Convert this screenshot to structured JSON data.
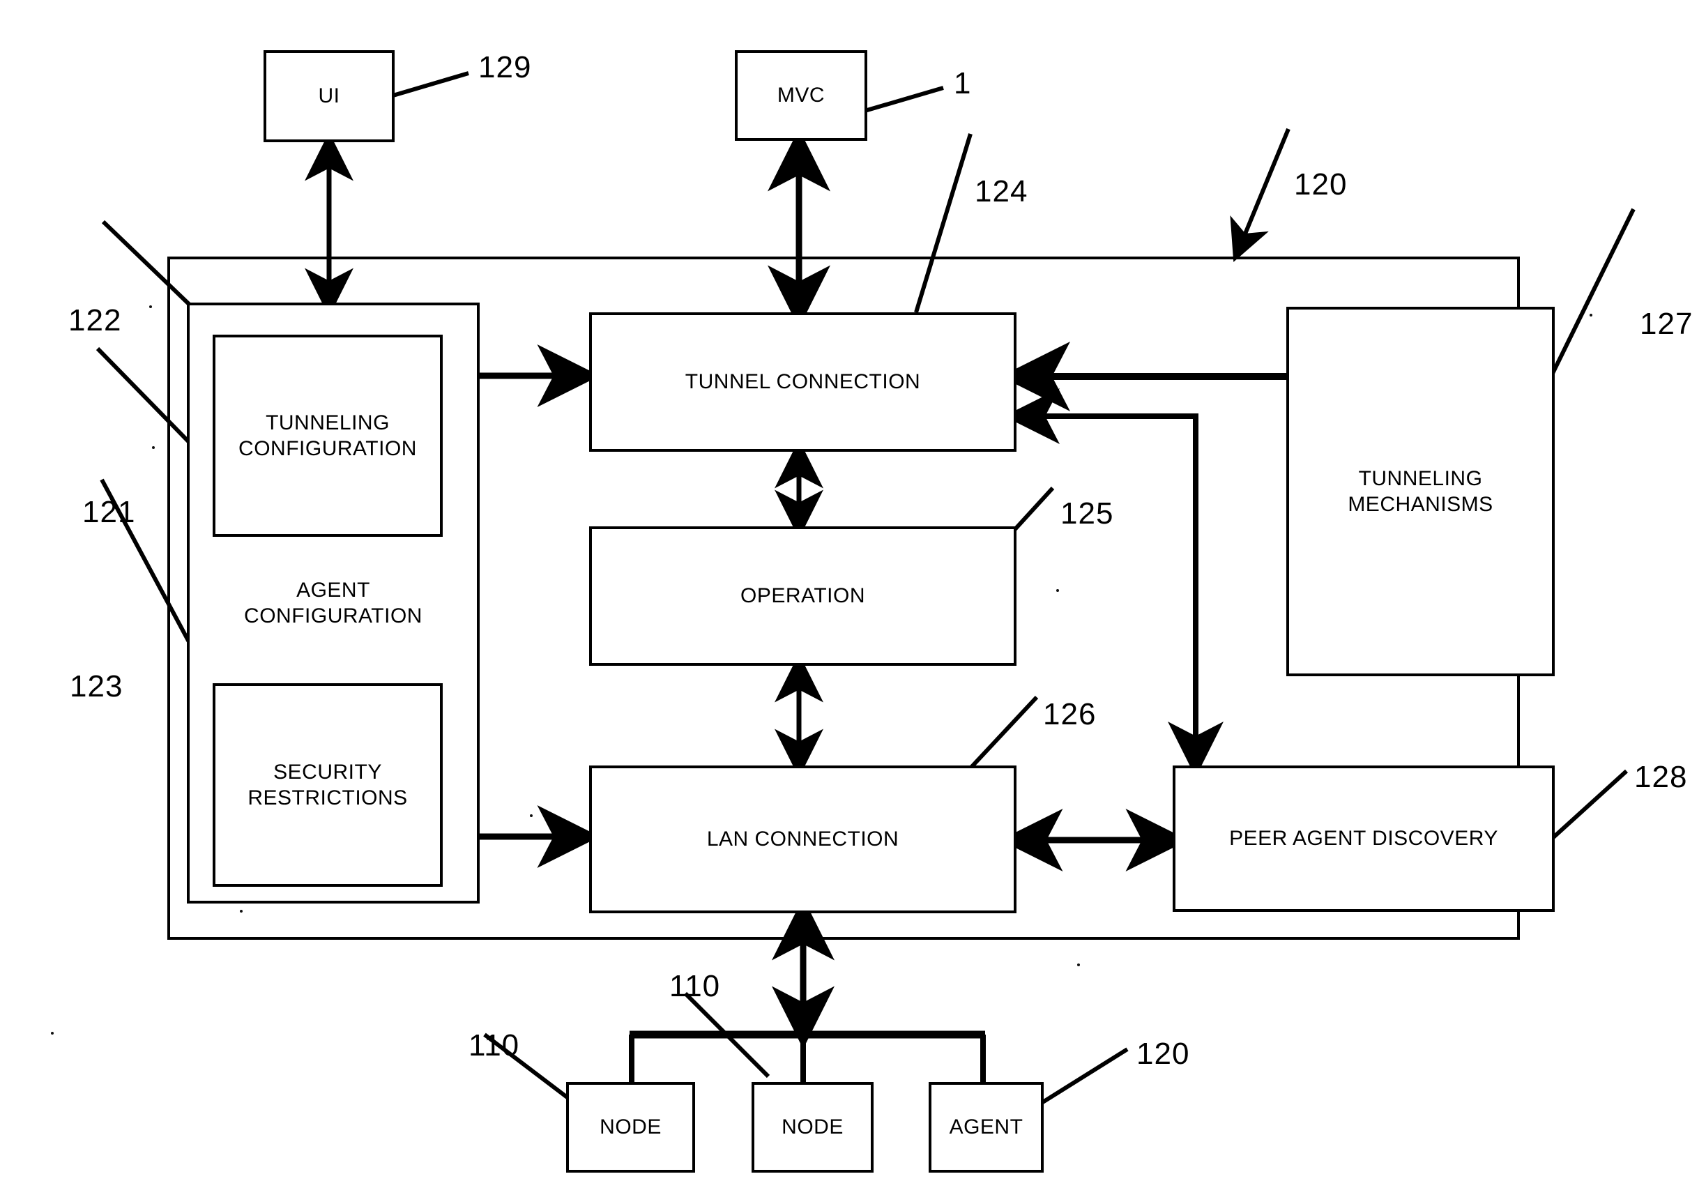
{
  "figure": {
    "type": "patent-block-diagram",
    "background": "#ffffff",
    "ink": "#000000"
  },
  "blocks": {
    "ui": {
      "label": "UI"
    },
    "mvc": {
      "label": "MVC"
    },
    "agent_configuration": {
      "label": "AGENT\nCONFIGURATION"
    },
    "tunneling_configuration": {
      "label": "TUNNELING\nCONFIGURATION"
    },
    "security_restrictions": {
      "label": "SECURITY\nRESTRICTIONS"
    },
    "tunnel_connection": {
      "label": "TUNNEL CONNECTION"
    },
    "operation": {
      "label": "OPERATION"
    },
    "lan_connection": {
      "label": "LAN CONNECTION"
    },
    "tunneling_mechanisms": {
      "label": "TUNNELING\nMECHANISMS"
    },
    "peer_agent_discovery": {
      "label": "PEER AGENT DISCOVERY"
    },
    "node_left": {
      "label": "NODE"
    },
    "node_middle": {
      "label": "NODE"
    },
    "agent_bottom": {
      "label": "AGENT"
    }
  },
  "reference_numerals": {
    "ref_129": "129",
    "ref_1": "1",
    "ref_120_top": "120",
    "ref_124": "124",
    "ref_127": "127",
    "ref_122": "122",
    "ref_121": "121",
    "ref_123": "123",
    "ref_125": "125",
    "ref_126": "126",
    "ref_128": "128",
    "ref_110_left": "110",
    "ref_110_middle": "110",
    "ref_120_bottom": "120"
  },
  "connections": [
    {
      "name": "ui-to-agent-container",
      "from": "ui",
      "to": "agent_container",
      "style": "double-arrow-vertical"
    },
    {
      "name": "mvc-to-tunnel-connection",
      "from": "mvc",
      "to": "tunnel_connection",
      "style": "double-arrow-vertical"
    },
    {
      "name": "tunneling-configuration-to-tunnel-connection",
      "from": "tunneling_configuration",
      "to": "tunnel_connection",
      "style": "single-arrow-right"
    },
    {
      "name": "security-restrictions-to-lan-connection",
      "from": "security_restrictions",
      "to": "lan_connection",
      "style": "single-arrow-right"
    },
    {
      "name": "tunnel-connection-to-operation",
      "from": "tunnel_connection",
      "to": "operation",
      "style": "double-arrow-vertical"
    },
    {
      "name": "operation-to-lan-connection",
      "from": "operation",
      "to": "lan_connection",
      "style": "double-arrow-vertical"
    },
    {
      "name": "tunneling-mechanisms-to-tunnel-connection",
      "from": "tunneling_mechanisms",
      "to": "tunnel_connection",
      "style": "single-arrow-left"
    },
    {
      "name": "tunnel-connection-to-peer-agent-discovery",
      "from": "tunnel_connection",
      "to": "peer_agent_discovery",
      "style": "elbow-arrow"
    },
    {
      "name": "lan-connection-to-peer-agent-discovery",
      "from": "lan_connection",
      "to": "peer_agent_discovery",
      "style": "double-arrow-horizontal"
    },
    {
      "name": "lan-connection-to-network-bus",
      "from": "lan_connection",
      "to": "network_bus",
      "style": "double-arrow-vertical"
    },
    {
      "name": "bus-to-node-left",
      "from": "network_bus",
      "to": "node_left",
      "style": "line"
    },
    {
      "name": "bus-to-node-middle",
      "from": "network_bus",
      "to": "node_middle",
      "style": "line"
    },
    {
      "name": "bus-to-agent-bottom",
      "from": "network_bus",
      "to": "agent_bottom",
      "style": "line"
    }
  ]
}
